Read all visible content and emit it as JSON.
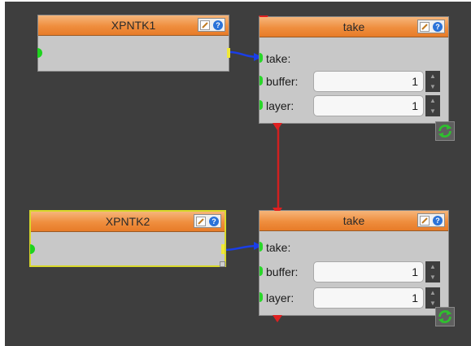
{
  "nodes": [
    {
      "title": "XPNTK1"
    },
    {
      "title": "XPNTK2"
    },
    {
      "title": "take",
      "input_label": "take:",
      "buffer_label": "buffer:",
      "buffer_value": "1",
      "layer_label": "layer:",
      "layer_value": "1"
    },
    {
      "title": "take",
      "input_label": "take:",
      "buffer_label": "buffer:",
      "buffer_value": "1",
      "layer_label": "layer:",
      "layer_value": "1"
    }
  ],
  "icons": {
    "edit": "pencil-icon",
    "help": "help-icon",
    "spin_up": "chevron-up-icon",
    "spin_down": "chevron-down-icon",
    "execute": "refresh-icon"
  },
  "help_glyph": "?",
  "colors": {
    "canvas": "#3e3e3e",
    "node_body": "#c8c8c8",
    "header": "#ef8e3e",
    "selected_border": "#d8d82a",
    "data_wire": "#1a3ee8",
    "flow_wire": "#d02020",
    "input_port": "#2ad62a"
  }
}
